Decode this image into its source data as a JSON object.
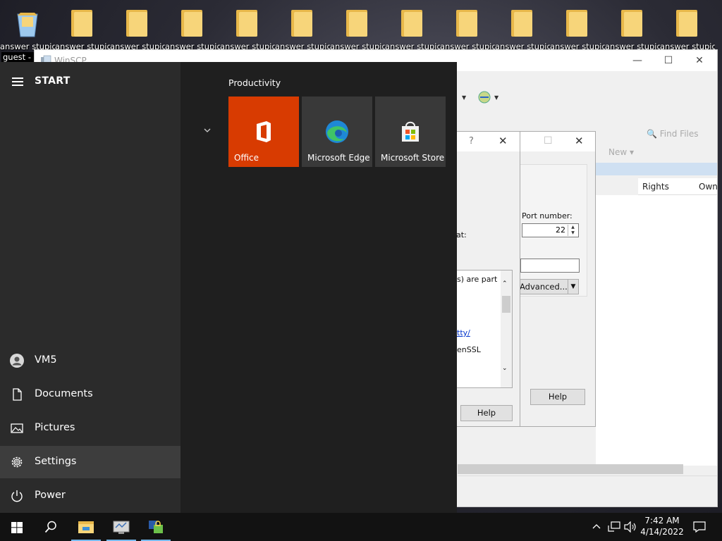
{
  "desktop": {
    "icon_labels": [
      "answer stupid",
      "answer stupid",
      "answer stupid",
      "answer stupid",
      "answer stupid",
      "answer stupid",
      "answer stupid",
      "answer stupid",
      "answer stupid",
      "answer stupid",
      "answer stupid",
      "answer stupid",
      "answer stupid"
    ],
    "guest_label": "guest - C"
  },
  "winscp": {
    "title": "WinSCP",
    "toolbar": {
      "find_files": "Find Files",
      "new": "New"
    },
    "columns": {
      "rights": "Rights",
      "owner": "Own"
    },
    "login": {
      "port_label": "Port number:",
      "port_value": "22",
      "at_label": "at:",
      "advanced_button": "Advanced...",
      "help_button": "Help"
    },
    "about": {
      "help_symbol": "?",
      "license_text_1": "s) are part",
      "license_link": "tty/",
      "license_text_2": "enSSL",
      "help_button": "Help"
    }
  },
  "start_menu": {
    "title": "START",
    "user": "VM5",
    "items": [
      "Documents",
      "Pictures",
      "Settings",
      "Power"
    ],
    "group": "Productivity",
    "tiles": [
      {
        "label": "Office",
        "color": "#d83b01"
      },
      {
        "label": "Microsoft Edge",
        "color": "#393939"
      },
      {
        "label": "Microsoft Store",
        "color": "#393939"
      }
    ]
  },
  "taskbar": {
    "time": "7:42 AM",
    "date": "4/14/2022"
  }
}
